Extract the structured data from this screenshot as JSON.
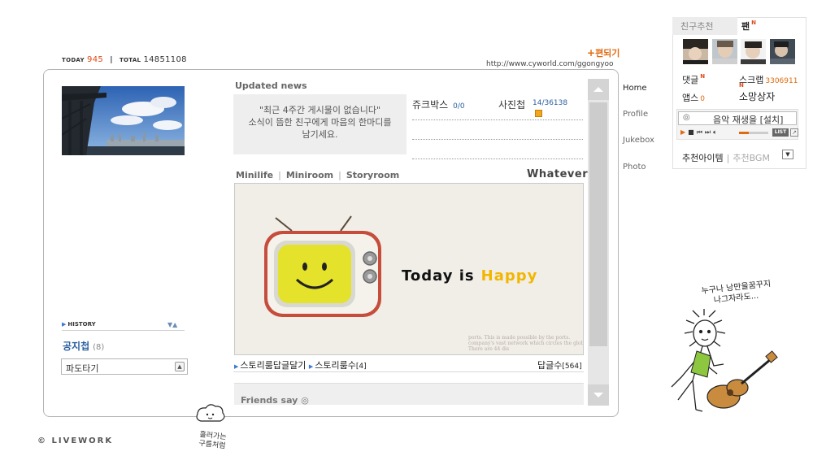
{
  "counters": {
    "today_label": "today",
    "today_value": "945",
    "separator": "|",
    "total_label": "total",
    "total_value": "14851108"
  },
  "edit_link": "편되기",
  "homepage_url": "http://www.cyworld.com/ggongyoo",
  "left": {
    "history_label": "HISTORY",
    "notice_title": "공지첩",
    "notice_count": "(8)",
    "wave_select": "파도타기"
  },
  "updated": {
    "title": "Updated news",
    "message_line1": "\"최근 4주간 게시물이 없습니다\"",
    "message_line2": "소식이 뜸한 친구에게 마음의 한마디를",
    "message_line3": "남기세요."
  },
  "jukebox": {
    "label": "쥬크박스",
    "count": "0/0"
  },
  "photo": {
    "label": "사진첩",
    "count": "14/36138"
  },
  "tabs": [
    "Minilife",
    "Miniroom",
    "Storyroom"
  ],
  "room_title": "Whatever",
  "miniroom": {
    "today_text": "Today is",
    "happy_text": "Happy",
    "paper_text": "ports. This is made possible by the ports. company's vast network which circles the globe. There are 44 dis"
  },
  "story": {
    "reply_label": "스토리룸답글달기",
    "count_label": "스토리룸수",
    "count_value": "[4]",
    "reply_count_label": "답글수",
    "reply_count_value": "[564]"
  },
  "friends_say": "Friends say",
  "nav": [
    "Home",
    "Profile",
    "Jukebox",
    "Photo"
  ],
  "right": {
    "tab_friend_rec": "친구추천",
    "tab_fan": "팬",
    "new_mark": "N",
    "reply_label": "댓글",
    "scrap_label": "스크랩",
    "scrap_value": "3306911",
    "apps_label": "앱스",
    "apps_value": "0",
    "wish_label": "소망상자",
    "music_text": "음악 재생을 [설치]",
    "list_label": "LIST",
    "rec_item": "추천아이템",
    "rec_sep": "|",
    "rec_bgm": "추천BGM"
  },
  "footer": {
    "brand": "LIVEWORK"
  },
  "doodles": {
    "guitar_line1": "누구나 낭만을꿈꾸지",
    "guitar_line2": "나그자라도...",
    "cloud_line1": "흘러가는",
    "cloud_line2": "구름처럼"
  },
  "colors": {
    "accent_orange": "#e06a10",
    "count_blue": "#2a5fa0",
    "happy_yellow": "#f2b600",
    "sky_blue": "#3f7cc6"
  }
}
